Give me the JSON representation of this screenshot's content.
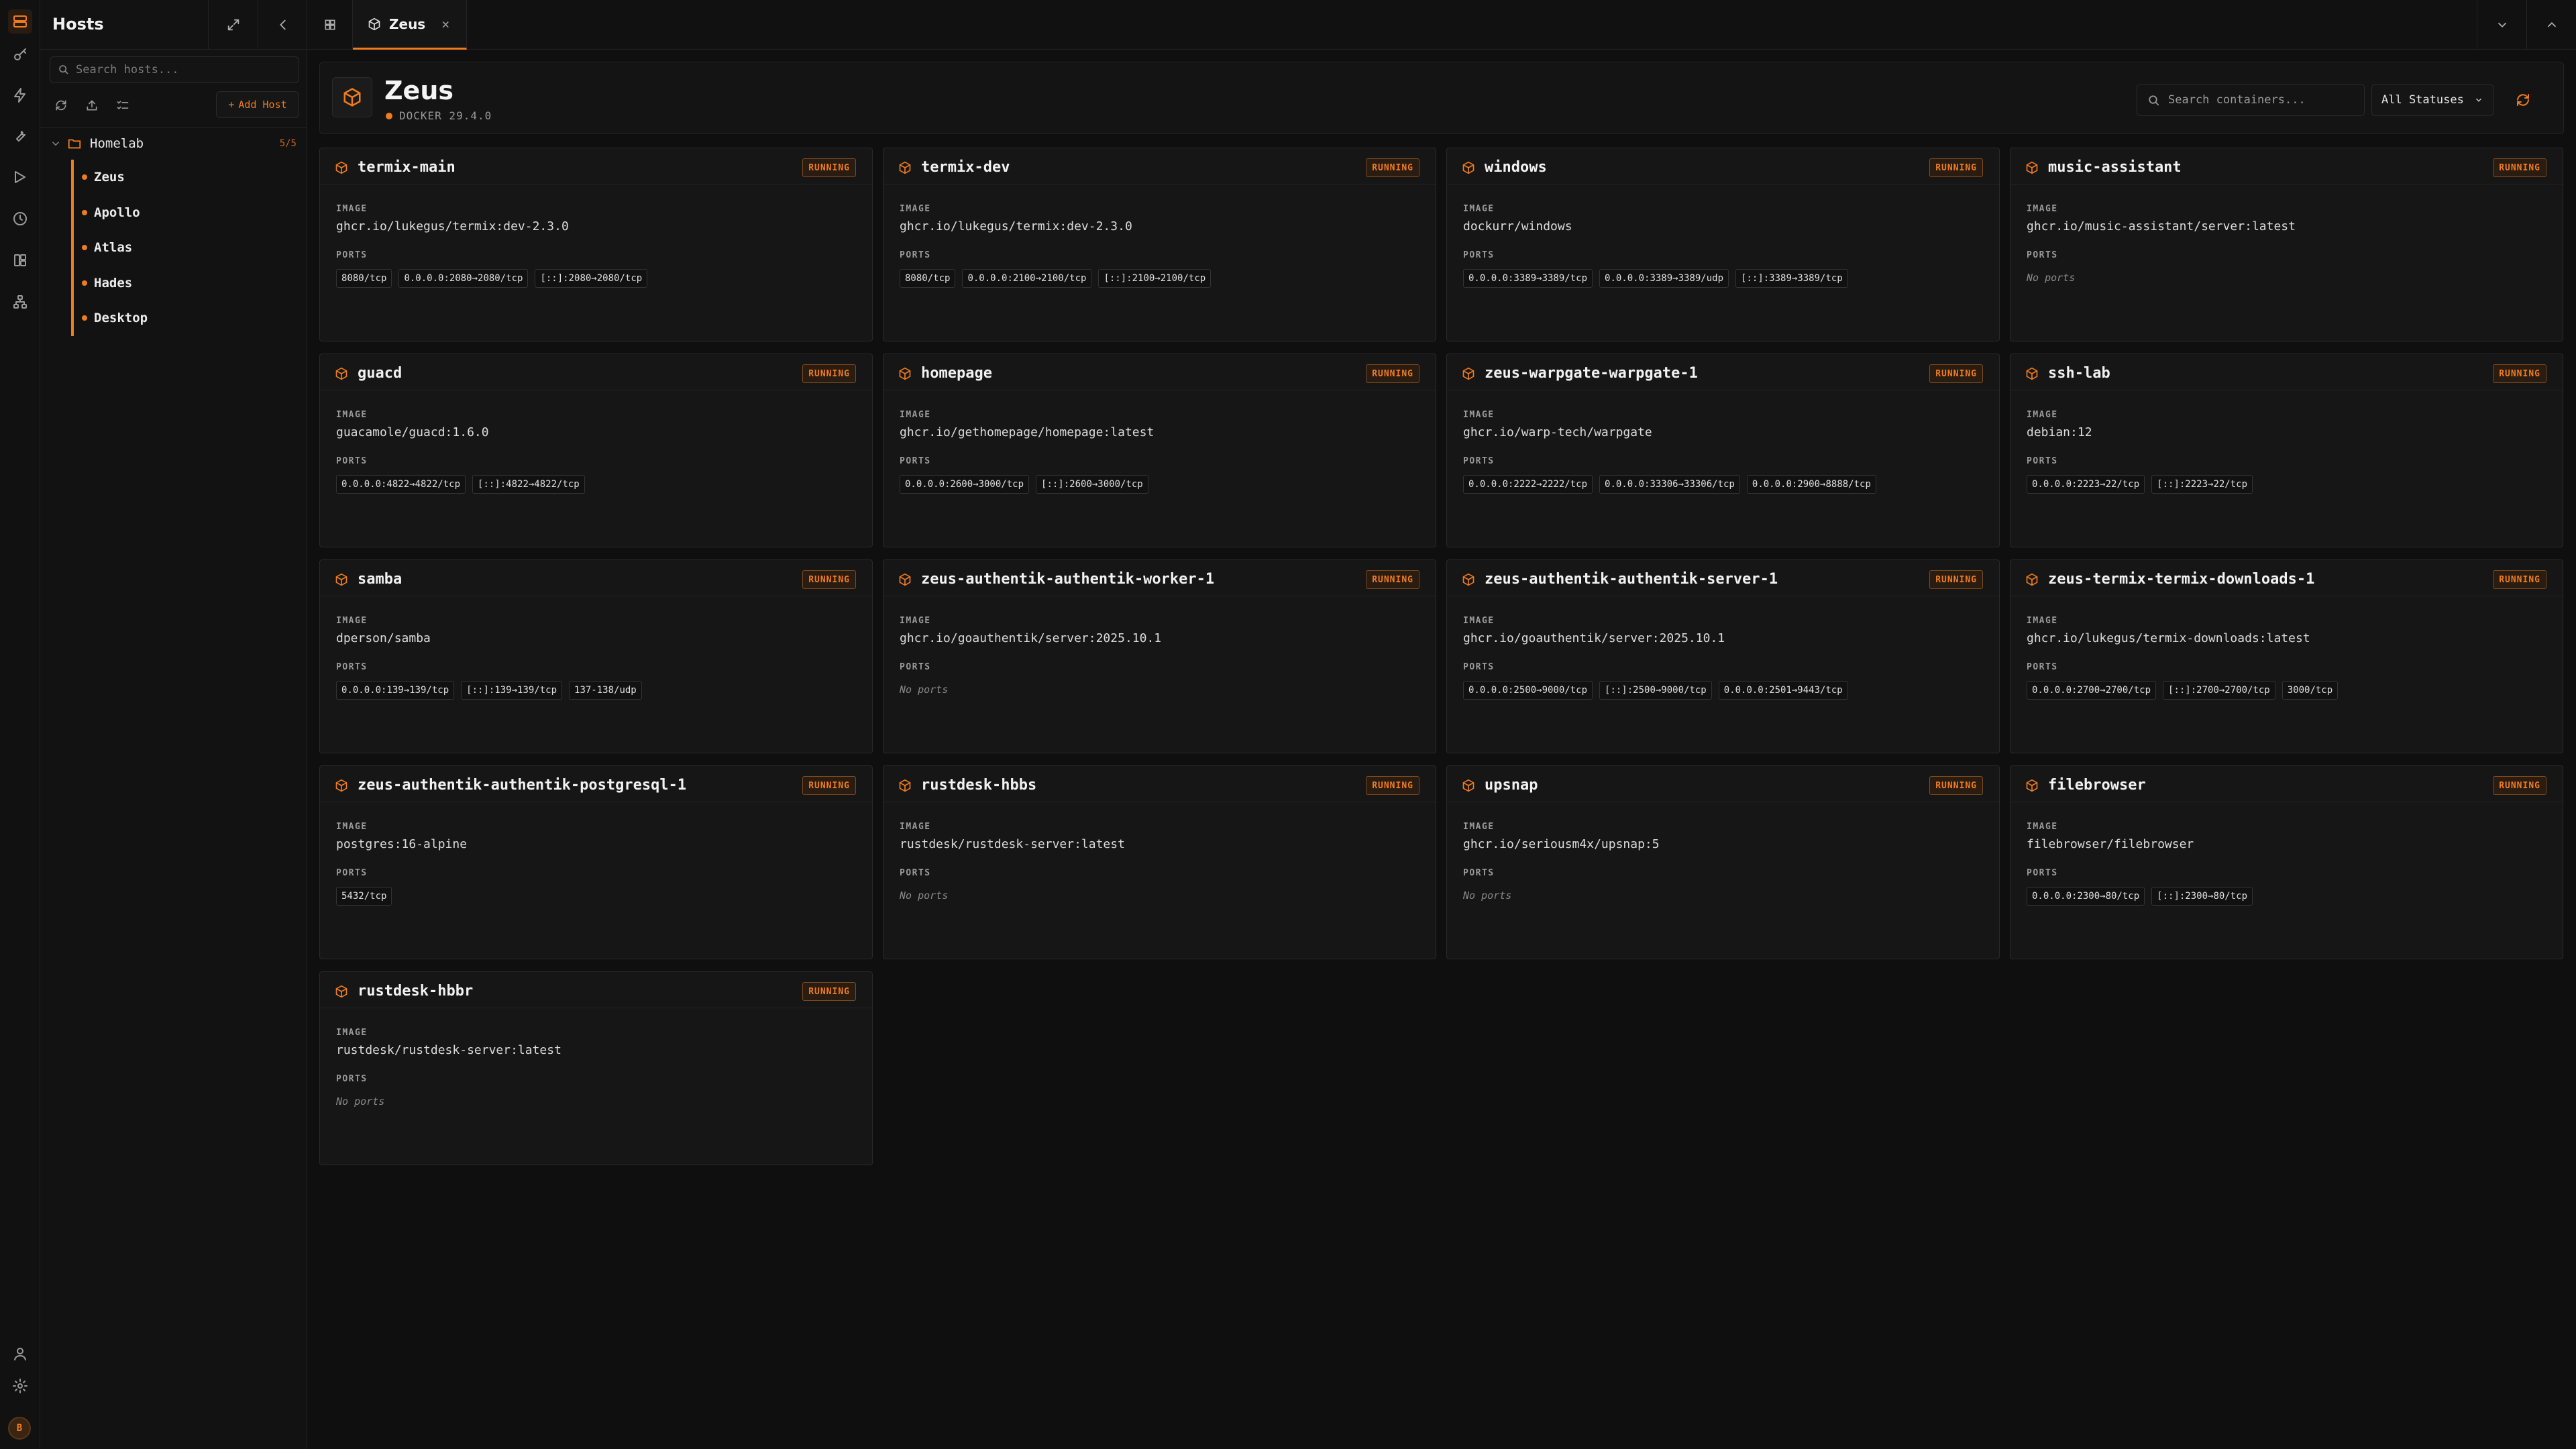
{
  "sidebar": {
    "title": "Hosts",
    "search_placeholder": "Search hosts...",
    "add_host_label": "Add Host",
    "folder": {
      "name": "Homelab",
      "count": "5/5"
    },
    "hosts": [
      {
        "name": "Zeus"
      },
      {
        "name": "Apollo"
      },
      {
        "name": "Atlas"
      },
      {
        "name": "Hades"
      },
      {
        "name": "Desktop"
      }
    ]
  },
  "user": {
    "avatar_initial": "B"
  },
  "tab": {
    "label": "Zeus",
    "close": "×"
  },
  "header": {
    "title": "Zeus",
    "subtitle": "DOCKER 29.4.0",
    "search_placeholder": "Search containers...",
    "status_filter": "All Statuses"
  },
  "labels": {
    "image": "IMAGE",
    "ports": "PORTS",
    "no_ports": "No ports"
  },
  "containers": [
    {
      "name": "termix-main",
      "status": "RUNNING",
      "image": "ghcr.io/lukegus/termix:dev-2.3.0",
      "ports": [
        "8080/tcp",
        "0.0.0.0:2080→2080/tcp",
        "[::]:2080→2080/tcp"
      ]
    },
    {
      "name": "termix-dev",
      "status": "RUNNING",
      "image": "ghcr.io/lukegus/termix:dev-2.3.0",
      "ports": [
        "8080/tcp",
        "0.0.0.0:2100→2100/tcp",
        "[::]:2100→2100/tcp"
      ]
    },
    {
      "name": "windows",
      "status": "RUNNING",
      "image": "dockurr/windows",
      "ports": [
        "0.0.0.0:3389→3389/tcp",
        "0.0.0.0:3389→3389/udp",
        "[::]:3389→3389/tcp"
      ]
    },
    {
      "name": "music-assistant",
      "status": "RUNNING",
      "image": "ghcr.io/music-assistant/server:latest",
      "ports": []
    },
    {
      "name": "guacd",
      "status": "RUNNING",
      "image": "guacamole/guacd:1.6.0",
      "ports": [
        "0.0.0.0:4822→4822/tcp",
        "[::]:4822→4822/tcp"
      ]
    },
    {
      "name": "homepage",
      "status": "RUNNING",
      "image": "ghcr.io/gethomepage/homepage:latest",
      "ports": [
        "0.0.0.0:2600→3000/tcp",
        "[::]:2600→3000/tcp"
      ]
    },
    {
      "name": "zeus-warpgate-warpgate-1",
      "status": "RUNNING",
      "image": "ghcr.io/warp-tech/warpgate",
      "ports": [
        "0.0.0.0:2222→2222/tcp",
        "0.0.0.0:33306→33306/tcp",
        "0.0.0.0:2900→8888/tcp"
      ]
    },
    {
      "name": "ssh-lab",
      "status": "RUNNING",
      "image": "debian:12",
      "ports": [
        "0.0.0.0:2223→22/tcp",
        "[::]:2223→22/tcp"
      ]
    },
    {
      "name": "samba",
      "status": "RUNNING",
      "image": "dperson/samba",
      "ports": [
        "0.0.0.0:139→139/tcp",
        "[::]:139→139/tcp",
        "137-138/udp"
      ]
    },
    {
      "name": "zeus-authentik-authentik-worker-1",
      "status": "RUNNING",
      "image": "ghcr.io/goauthentik/server:2025.10.1",
      "ports": []
    },
    {
      "name": "zeus-authentik-authentik-server-1",
      "status": "RUNNING",
      "image": "ghcr.io/goauthentik/server:2025.10.1",
      "ports": [
        "0.0.0.0:2500→9000/tcp",
        "[::]:2500→9000/tcp",
        "0.0.0.0:2501→9443/tcp"
      ]
    },
    {
      "name": "zeus-termix-termix-downloads-1",
      "status": "RUNNING",
      "image": "ghcr.io/lukegus/termix-downloads:latest",
      "ports": [
        "0.0.0.0:2700→2700/tcp",
        "[::]:2700→2700/tcp",
        "3000/tcp"
      ]
    },
    {
      "name": "zeus-authentik-authentik-postgresql-1",
      "status": "RUNNING",
      "image": "postgres:16-alpine",
      "ports": [
        "5432/tcp"
      ]
    },
    {
      "name": "rustdesk-hbbs",
      "status": "RUNNING",
      "image": "rustdesk/rustdesk-server:latest",
      "ports": []
    },
    {
      "name": "upsnap",
      "status": "RUNNING",
      "image": "ghcr.io/seriousm4x/upsnap:5",
      "ports": []
    },
    {
      "name": "filebrowser",
      "status": "RUNNING",
      "image": "filebrowser/filebrowser",
      "ports": [
        "0.0.0.0:2300→80/tcp",
        "[::]:2300→80/tcp"
      ]
    },
    {
      "name": "rustdesk-hbbr",
      "status": "RUNNING",
      "image": "rustdesk/rustdesk-server:latest",
      "ports": []
    }
  ],
  "colors": {
    "accent": "#f07c1e",
    "background": "#0f0f0f",
    "card": "#161616"
  }
}
